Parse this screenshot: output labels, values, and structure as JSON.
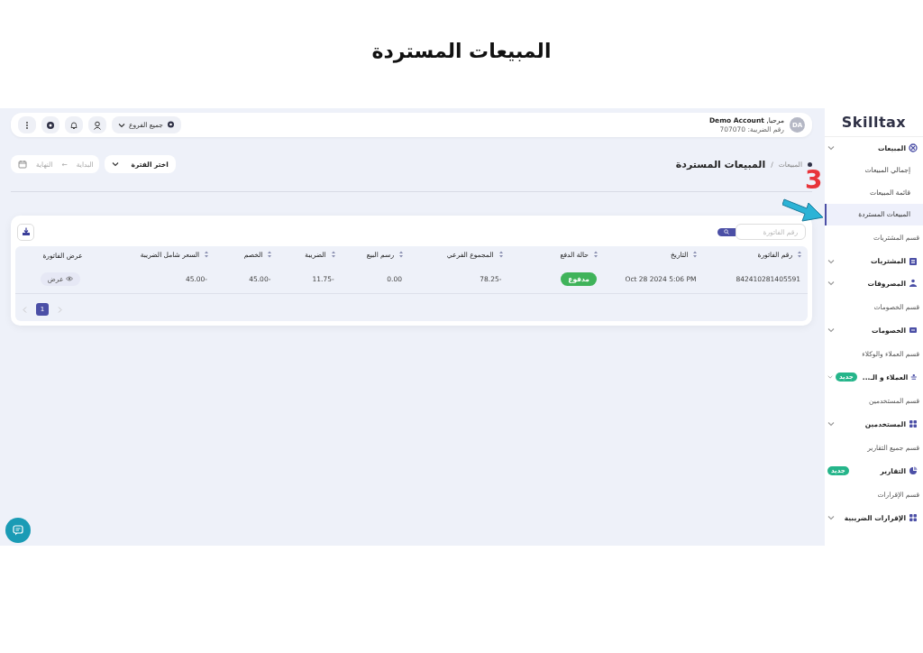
{
  "page_title": "المبيعات المستردة",
  "annotation": {
    "number": "3"
  },
  "sidebar": {
    "logo": "Skilltax",
    "items": [
      {
        "kind": "group",
        "label": "المبيعات"
      },
      {
        "kind": "sub",
        "label": "إجمالي المبيعات",
        "selected": false
      },
      {
        "kind": "sub",
        "label": "قائمة المبيعات",
        "selected": false
      },
      {
        "kind": "sub",
        "label": "المبيعات المستردة",
        "selected": true
      },
      {
        "kind": "section",
        "label": "قسم المشتريات"
      },
      {
        "kind": "group",
        "label": "المشتريات"
      },
      {
        "kind": "group",
        "label": "المصروفات"
      },
      {
        "kind": "section",
        "label": "قسم الخصومات"
      },
      {
        "kind": "group",
        "label": "الخصومات"
      },
      {
        "kind": "section",
        "label": "قسم العملاء والوكلاء"
      },
      {
        "kind": "group",
        "label": "العملاء و الـ...",
        "badge": "جديد"
      },
      {
        "kind": "section",
        "label": "قسم المستخدمين"
      },
      {
        "kind": "group",
        "label": "المستخدمين"
      },
      {
        "kind": "section",
        "label": "قسم جميع التقارير"
      },
      {
        "kind": "link",
        "label": "التقارير",
        "badge": "جديد"
      },
      {
        "kind": "section",
        "label": "قسم الإقرارات"
      },
      {
        "kind": "group",
        "label": "الإقرارات الضريبية"
      }
    ]
  },
  "topbar": {
    "avatar": "DA",
    "greeting": "مرحبا, **Demo Account**",
    "tax_number": "رقم الضريبة: 707070",
    "branch": "جميع الفروع"
  },
  "header": {
    "breadcrumb": "المبيعات",
    "separator": "/",
    "title": "المبيعات المستردة",
    "period": "اختر الفترة",
    "start_placeholder": "البداية",
    "end_placeholder": "النهاية",
    "range_arrow": "←"
  },
  "table": {
    "search_placeholder": "رقم الفاتورة",
    "columns": [
      {
        "label": "رقم الفاتورة",
        "sortable": true
      },
      {
        "label": "التاريخ",
        "sortable": true
      },
      {
        "label": "حالة الدفع",
        "sortable": true
      },
      {
        "label": "المجموع الفرعي",
        "sortable": true
      },
      {
        "label": "رسم البيع",
        "sortable": true
      },
      {
        "label": "الضريبة",
        "sortable": true
      },
      {
        "label": "الخصم",
        "sortable": true
      },
      {
        "label": "السعر شامل الضريبة",
        "sortable": true
      },
      {
        "label": "عرض الفاتورة",
        "sortable": false
      }
    ],
    "rows": [
      [
        {
          "kind": "text",
          "text": "842410281405591"
        },
        {
          "kind": "text",
          "text": "Oct 28 2024 5:06 PM"
        },
        {
          "kind": "status",
          "text": "مدفوع"
        },
        {
          "kind": "number",
          "text": "78.25-"
        },
        {
          "kind": "number",
          "text": "0.00"
        },
        {
          "kind": "number",
          "text": "11.75-"
        },
        {
          "kind": "number",
          "text": "45.00-"
        },
        {
          "kind": "number",
          "text": "45.00-"
        },
        {
          "kind": "view",
          "text": "عرض"
        }
      ]
    ],
    "pages": [
      {
        "label": "1",
        "selected": true
      }
    ]
  }
}
